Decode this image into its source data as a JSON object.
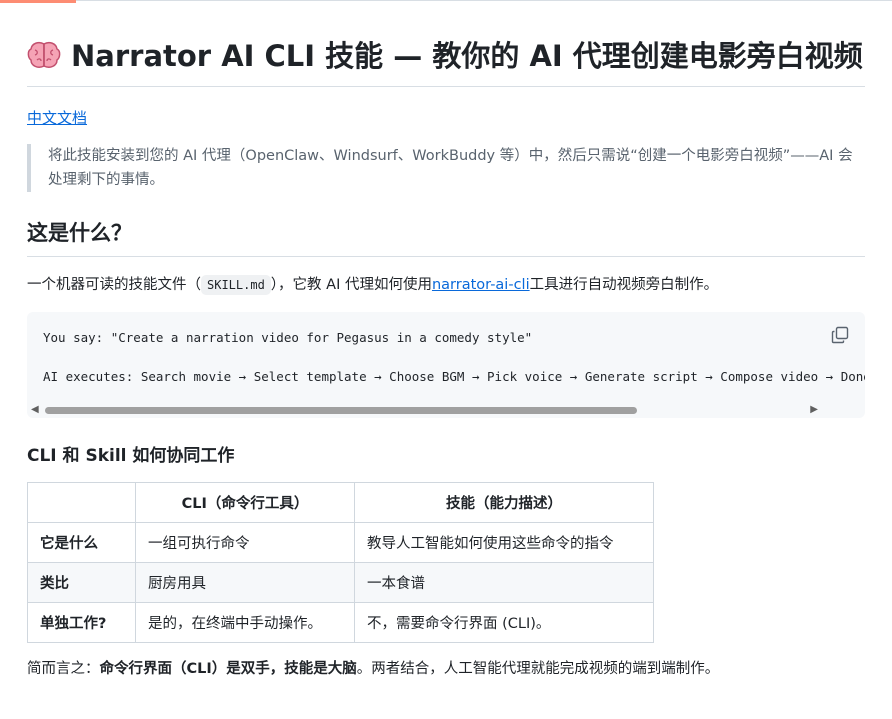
{
  "title": {
    "emoji_icon": "brain-icon",
    "text": "Narrator AI CLI 技能 — 教你的 AI 代理创建电影旁白视频"
  },
  "lang_link": "中文文档",
  "quote": "将此技能安装到您的 AI 代理（OpenClaw、Windsurf、WorkBuddy 等）中，然后只需说“创建一个电影旁白视频”——AI 会处理剩下的事情。",
  "what_is": {
    "heading": "这是什么？",
    "desc_before": "一个机器可读的技能文件（",
    "desc_code": "SKILL.md",
    "desc_middle": "），它教 AI 代理如何使用",
    "desc_link": "narrator-ai-cli",
    "desc_after": "工具进行自动视频旁白制作。"
  },
  "code_block": {
    "line1": "You say: \"Create a narration video for Pegasus in a comedy style\"",
    "line2": "AI executes: Search movie → Select template → Choose BGM → Pick voice → Generate script → Compose video → Done!",
    "copy_icon": "copy-icon",
    "scroll_fraction": 0.78
  },
  "how": {
    "heading": "CLI 和 Skill 如何协同工作"
  },
  "table": {
    "headers": [
      "",
      "CLI（命令行工具）",
      "技能（能力描述）"
    ],
    "rows": [
      [
        "它是什么",
        "一组可执行命令",
        "教导人工智能如何使用这些命令的指令"
      ],
      [
        "类比",
        "厨房用具",
        "一本食谱"
      ],
      [
        "单独工作?",
        "是的，在终端中手动操作。",
        "不，需要命令行界面 (CLI)。"
      ]
    ]
  },
  "summary": {
    "prefix": "简而言之：",
    "bold": "命令行界面（CLI）是双手，技能是大脑",
    "suffix": "。两者结合，人工智能代理就能完成视频的端到端制作。"
  }
}
